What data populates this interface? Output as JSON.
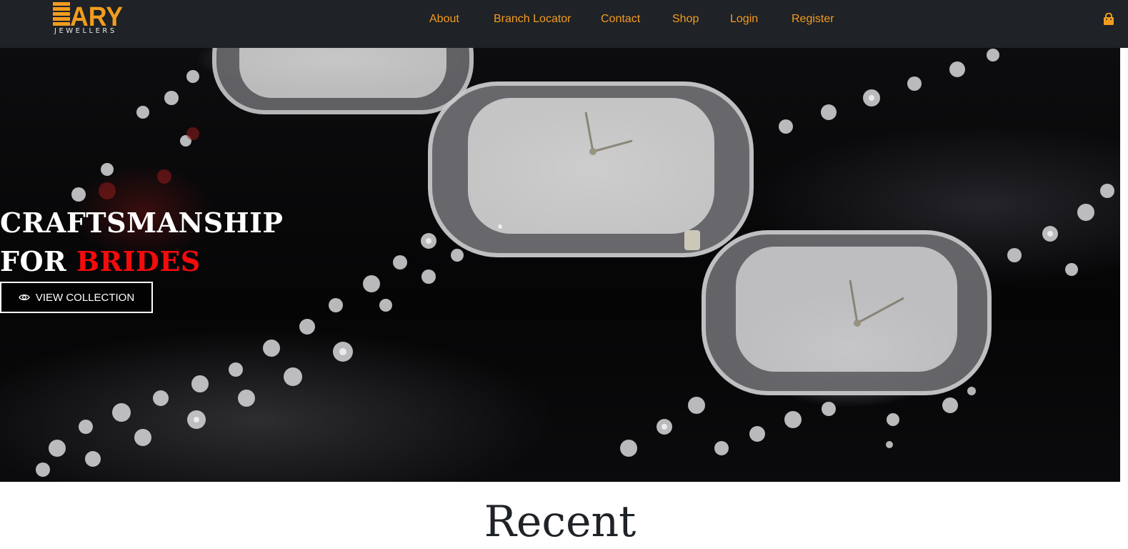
{
  "brand": {
    "logo_text": "ARY",
    "logo_subtext": "JEWELLERS",
    "accent_color": "#f29c1f",
    "logo_icon": "ary-jewellers-logo"
  },
  "nav": {
    "items": [
      {
        "label": "About"
      },
      {
        "label": "Branch Locator"
      },
      {
        "label": "Contact"
      },
      {
        "label": "Shop"
      },
      {
        "label": "Login"
      },
      {
        "label": "Register"
      }
    ],
    "cart_icon": "shopping-bag-icon"
  },
  "hero": {
    "title_line1": "CRAFTSMANSHIP",
    "title_line2_prefix": "FOR",
    "title_line2_accent": "BRIDES",
    "accent_color": "#f40b0b",
    "button_label": "VIEW COLLECTION",
    "button_icon": "eye-icon",
    "image": "diamond-studded-watches-photo"
  },
  "recent": {
    "heading": "Recent"
  }
}
